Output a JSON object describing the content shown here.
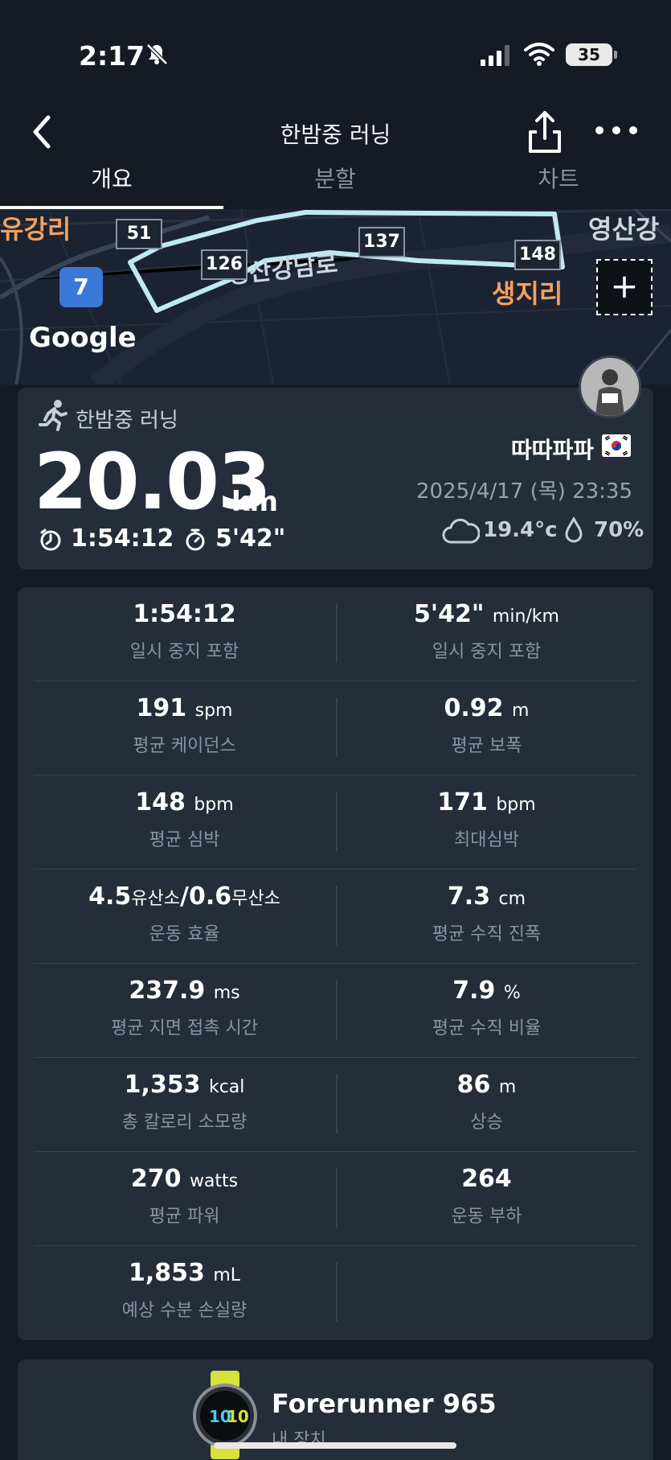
{
  "status_bar": {
    "time": "2:17",
    "battery": "35"
  },
  "header": {
    "title": "한밤중 러닝"
  },
  "tabs": [
    {
      "label": "개요"
    },
    {
      "label": "분할"
    },
    {
      "label": "차트"
    }
  ],
  "map": {
    "labels": {
      "left": "유강리",
      "right": "생지리",
      "road": "영산강남로",
      "top_right": "영산강"
    },
    "route_badge": "7",
    "km_markers": [
      "51",
      "126",
      "137",
      "148"
    ],
    "provider": "Google"
  },
  "summary": {
    "activity_type": "한밤중 러닝",
    "distance": "20.03",
    "distance_unit": "km",
    "time": "1:54:12",
    "pace": "5'42\"",
    "username": "따따파파",
    "datetime": "2025/4/17 (목) 23:35",
    "temperature": "19.4°c",
    "humidity": "70%"
  },
  "stats": [
    {
      "left": {
        "value": "1:54:12",
        "unit": "",
        "label": "일시 중지 포함"
      },
      "right": {
        "value": "5'42\"",
        "unit": "min/km",
        "label": "일시 중지 포함"
      }
    },
    {
      "left": {
        "value": "191",
        "unit": "spm",
        "label": "평균 케이던스"
      },
      "right": {
        "value": "0.92",
        "unit": "m",
        "label": "평균 보폭"
      }
    },
    {
      "left": {
        "value": "148",
        "unit": "bpm",
        "label": "평균 심박"
      },
      "right": {
        "value": "171",
        "unit": "bpm",
        "label": "최대심박"
      }
    },
    {
      "left": {
        "value": "4.5",
        "unit": "유산소",
        "value2": "0.6",
        "unit2": "무산소",
        "label": "운동 효율"
      },
      "right": {
        "value": "7.3",
        "unit": "cm",
        "label": "평균 수직 진폭"
      }
    },
    {
      "left": {
        "value": "237.9",
        "unit": "ms",
        "label": "평균 지면 접촉 시간"
      },
      "right": {
        "value": "7.9",
        "unit": "%",
        "label": "평균 수직 비율"
      }
    },
    {
      "left": {
        "value": "1,353",
        "unit": "kcal",
        "label": "총 칼로리 소모량"
      },
      "right": {
        "value": "86",
        "unit": "m",
        "label": "상승"
      }
    },
    {
      "left": {
        "value": "270",
        "unit": "watts",
        "label": "평균 파워"
      },
      "right": {
        "value": "264",
        "unit": "",
        "label": "운동 부하"
      }
    },
    {
      "left": {
        "value": "1,853",
        "unit": "mL",
        "label": "예상 수분 손실량"
      }
    }
  ],
  "device": {
    "name": "Forerunner 965",
    "subtitle": "내 장치",
    "watch_face_time": "10",
    "watch_face_time2": "10"
  },
  "colors": {
    "background": "#151a24",
    "card": "#252c3a",
    "route": "#bfe9f2",
    "map_label_orange": "#f0a060",
    "muted_text": "#8a93a3"
  }
}
